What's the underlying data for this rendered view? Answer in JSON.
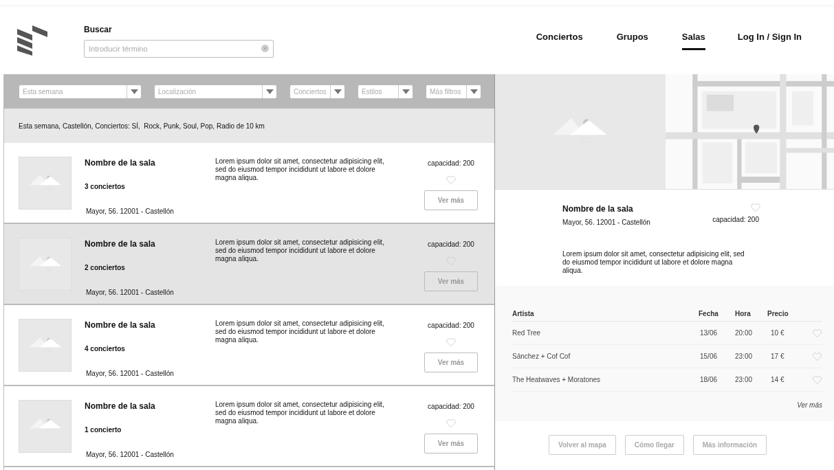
{
  "header": {
    "search": {
      "label": "Buscar",
      "placeholder": "Introducir término"
    },
    "nav": [
      {
        "label": "Conciertos",
        "selected": false
      },
      {
        "label": "Grupos",
        "selected": false
      },
      {
        "label": "Salas",
        "selected": true
      },
      {
        "label": "Log In / Sign In",
        "selected": false
      }
    ]
  },
  "filters": [
    {
      "placeholder": "Esta semana",
      "kind": "wide"
    },
    {
      "placeholder": "Localización",
      "kind": "wide"
    },
    {
      "placeholder": "Conciertos",
      "kind": "narrow"
    },
    {
      "placeholder": "Estilos",
      "kind": "narrow"
    },
    {
      "placeholder": "Más filtros",
      "kind": "narrow"
    }
  ],
  "summary": "Esta semana, Castellón, Conciertos: SÍ,  Rock, Punk, Soul, Pop, Radio de 10 km",
  "venues": [
    {
      "name": "Nombre de la sala",
      "concerts": "3 conciertos",
      "address": "Mayor, 56. 12001 - Castellón",
      "description": "Lorem ipsum dolor sit amet, consectetur adipisicing elit, sed do eiusmod tempor incididunt ut labore et dolore magna aliqua.",
      "capacity": "capacidad: 200",
      "button": "Ver más",
      "selected": false
    },
    {
      "name": "Nombre de la sala",
      "concerts": "2 conciertos",
      "address": "Mayor, 56. 12001 - Castellón",
      "description": "Lorem ipsum dolor sit amet, consectetur adipisicing elit, sed do eiusmod tempor incididunt ut labore et dolore magna aliqua.",
      "capacity": "capacidad: 200",
      "button": "Ver más",
      "selected": true
    },
    {
      "name": "Nombre de la sala",
      "concerts": "4 conciertos",
      "address": "Mayor, 56. 12001 - Castellón",
      "description": "Lorem ipsum dolor sit amet, consectetur adipisicing elit, sed do eiusmod tempor incididunt ut labore et dolore magna aliqua.",
      "capacity": "capacidad: 200",
      "button": "Ver más",
      "selected": false
    },
    {
      "name": "Nombre de la sala",
      "concerts": "1 concierto",
      "address": "Mayor, 56. 12001 - Castellón",
      "description": "Lorem ipsum dolor sit amet, consectetur adipisicing elit, sed do eiusmod tempor incididunt ut labore et dolore magna aliqua.",
      "capacity": "capacidad: 200",
      "button": "Ver más",
      "selected": false
    }
  ],
  "detail": {
    "name": "Nombre de la sala",
    "address": "Mayor, 56. 12001 - Castellón",
    "capacity": "capacidad: 200",
    "description": "Lorem ipsum dolor sit amet, consectetur adipisicing elit, sed do eiusmod tempor incididunt ut labore et dolore magna aliqua.",
    "table": {
      "columns": [
        "Artista",
        "Fecha",
        "Hora",
        "Precio"
      ],
      "rows": [
        [
          "Red Tree",
          "13/06",
          "20:00",
          "10 €"
        ],
        [
          "Sánchez + Cof Cof",
          "15/06",
          "23:00",
          "17 €"
        ],
        [
          "The Heatwaves + Moratones",
          "18/06",
          "23:00",
          "14 €"
        ]
      ],
      "more_link": "Ver más"
    },
    "buttons": [
      "Volver al mapa",
      "Cómo llegar",
      "Más información"
    ]
  }
}
